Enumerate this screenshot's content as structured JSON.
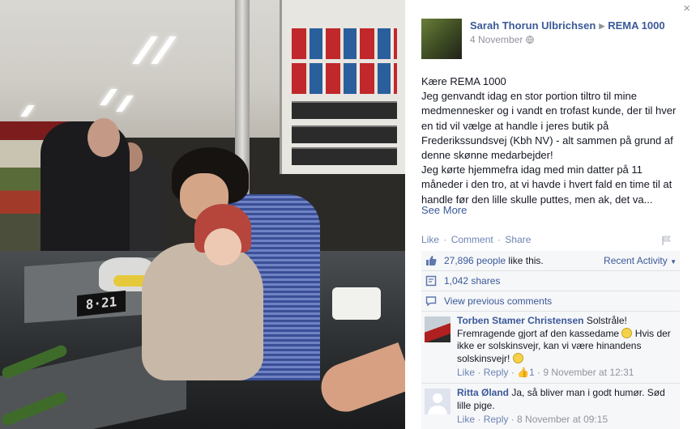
{
  "photo": {
    "register_display": "8·21"
  },
  "post": {
    "author": "Sarah Thorun Ulbrichsen",
    "target_page": "REMA 1000",
    "date": "4 November",
    "audience_icon": "globe-icon",
    "body": "Kære REMA 1000\nJeg genvandt idag en stor portion tiltro til mine medmennesker og i vandt en trofast kunde, der til hver en tid vil vælge at handle i jeres butik på Frederikssundsvej (Kbh NV) - alt sammen på grund af denne skønne medarbejder!\nJeg kørte hjemmefra idag med min datter på 11 måneder i den tro, at vi havde i hvert fald en time til at handle før den lille skulle puttes, men ak, det va...",
    "see_more": "See More"
  },
  "actions": {
    "like": "Like",
    "comment": "Comment",
    "share": "Share",
    "separator": "·"
  },
  "ufi": {
    "likes_count": "27,896 people",
    "likes_suffix": " like this.",
    "recent_activity": "Recent Activity",
    "shares": "1,042 shares",
    "view_previous": "View previous comments"
  },
  "comments": [
    {
      "name": "Torben Stamer Christensen",
      "text_1": "Solstråle! Fremragende gjort af den kassedame",
      "text_2": "Hvis der ikke er solskinsvejr, kan vi være hinandens solskinsvejr!",
      "like": "Like",
      "reply": "Reply",
      "like_count": "1",
      "time": "9 November at 12:31"
    },
    {
      "name": "Ritta Øland",
      "text_1": "Ja, så bliver man i godt humør. Sød lille pige.",
      "like": "Like",
      "reply": "Reply",
      "time": "8 November at 09:15"
    }
  ],
  "close": "×",
  "colors": {
    "link": "#3b5998",
    "muted": "#90949c",
    "ufi_bg": "#f6f7f9"
  }
}
